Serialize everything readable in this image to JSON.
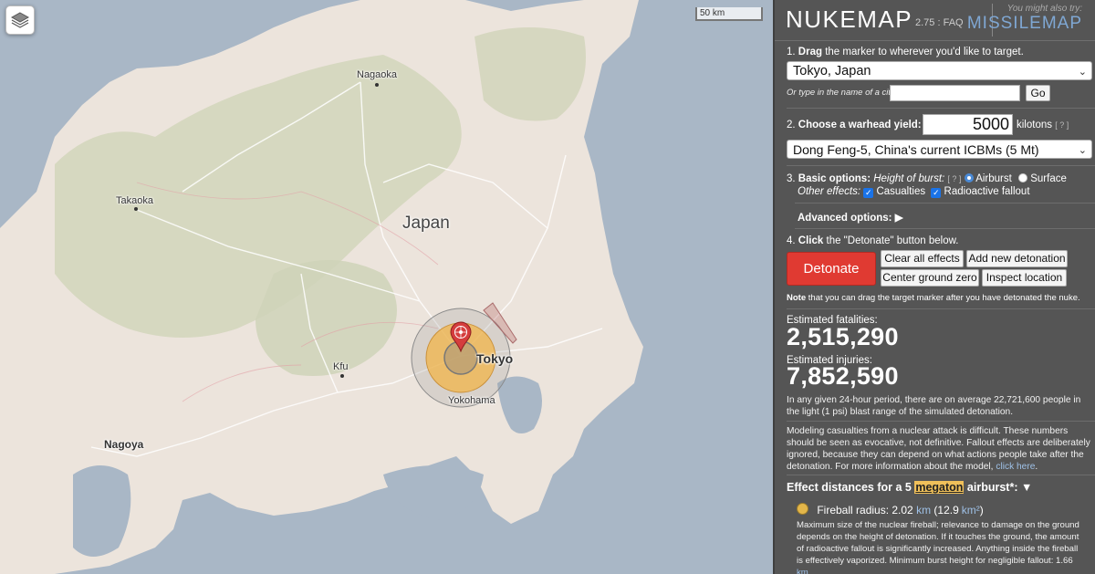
{
  "map": {
    "scale_label": "50 km",
    "labels": {
      "nagaoka": "Nagaoka",
      "takaoka": "Takaoka",
      "japan": "Japan",
      "kfu": "Kfu",
      "tokyo": "Tokyo",
      "yokohama": "Yokohama",
      "nagoya": "Nagoya"
    },
    "colors": {
      "water": "#a9b7c6",
      "land": "#ece4dc",
      "forest": "#cbd2b3",
      "fireball": "#f2b44a",
      "marker": "#d53d3d"
    }
  },
  "panel": {
    "logo": "NUKEMAP",
    "version": "2.75",
    "version_sep": " : ",
    "faq": "FAQ",
    "try_text": "You might also try:",
    "missilemap": "MISSILEMAP",
    "step1_num": "1.",
    "step1_bold": "Drag",
    "step1_rest": "the marker to wherever you'd like to target.",
    "city_select": "Tokyo, Japan",
    "city_prompt": "Or type in the name of a city:",
    "city_input": "",
    "go_button": "Go",
    "step2_num": "2.",
    "step2_bold": "Choose a warhead yield:",
    "help_mark": "[ ? ]",
    "yield_value": "5000",
    "yield_unit": "kilotons",
    "warhead_select": "Dong Feng-5, China's current ICBMs (5 Mt)",
    "step3_num": "3.",
    "step3_bold": "Basic options:",
    "height_label": "Height of burst:",
    "airburst": "Airburst",
    "surface": "Surface",
    "other_effects": "Other effects:",
    "casualties": "Casualties",
    "fallout": "Radioactive fallout",
    "advanced": "Advanced options: ▶",
    "step4_num": "4.",
    "step4_bold": "Click",
    "step4_rest": "the \"Detonate\" button below.",
    "detonate": "Detonate",
    "clear_all": "Clear all effects",
    "add_new": "Add new detonation",
    "center_gz": "Center ground zero",
    "inspect": "Inspect location",
    "note_bold": "Note",
    "note_rest": "that you can drag the target marker after you have detonated the nuke.",
    "fatalities_label": "Estimated fatalities:",
    "fatalities_value": "2,515,290",
    "injuries_label": "Estimated injuries:",
    "injuries_value": "7,852,590",
    "population_text": "In any given 24-hour period, there are on average 22,721,600 people in the light (1 psi) blast range of the simulated detonation.",
    "model_text": "Modeling casualties from a nuclear attack is difficult. These numbers should be seen as evocative, not definitive. Fallout effects are deliberately ignored, because they can depend on what actions people take after the detonation. For more information about the model,",
    "click_here": "click here",
    "period": ".",
    "effects_prefix": "Effect distances for a 5",
    "effects_megaton": "megaton",
    "effects_suffix": "airburst*: ▼",
    "fireball_label": "Fireball radius: 2.02",
    "fireball_km": "km",
    "fireball_area_open": "(12.9",
    "fireball_km2": "km²",
    "fireball_area_close": ")",
    "fireball_desc": "Maximum size of the nuclear fireball; relevance to damage on the ground depends on the height of detonation. If it touches the ground, the amount of radioactive fallout is significantly increased. Anything inside the fireball is effectively vaporized. Minimum burst height for negligible fallout: 1.66",
    "fireball_desc_km": "km"
  }
}
